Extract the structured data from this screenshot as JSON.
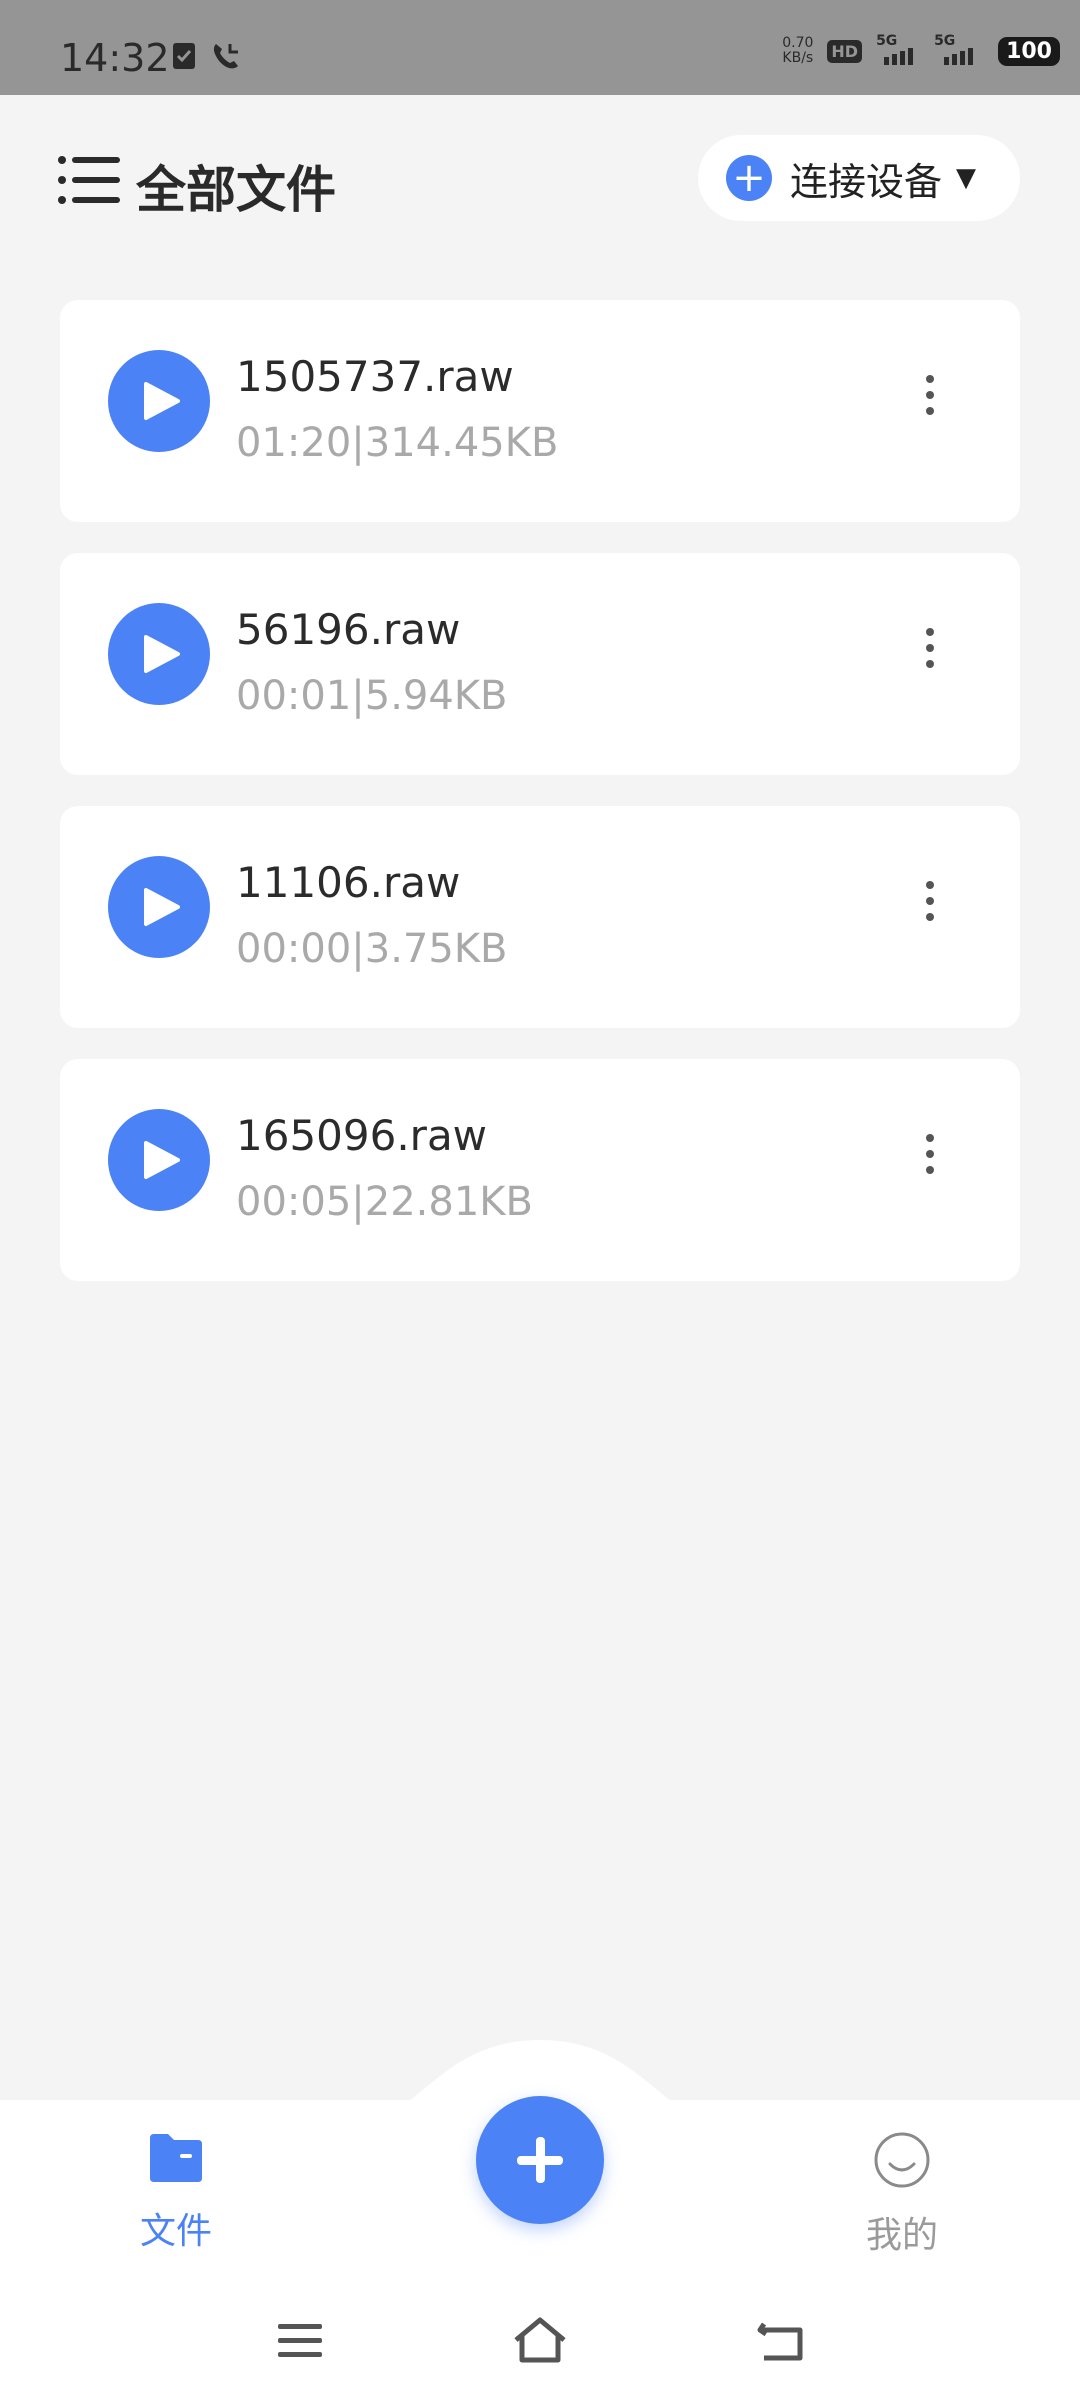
{
  "status_bar": {
    "time": "14:32",
    "net_speed_value": "0.70",
    "net_speed_unit": "KB/s",
    "hd_label": "HD",
    "signal1_label": "5G",
    "signal2_label": "5G",
    "battery": "100"
  },
  "header": {
    "title": "全部文件",
    "connect_label": "连接设备",
    "menu_icon": "list-menu-icon"
  },
  "files": [
    {
      "name": "1505737.raw",
      "meta": "01:20|314.45KB"
    },
    {
      "name": "56196.raw",
      "meta": "00:01|5.94KB"
    },
    {
      "name": "11106.raw",
      "meta": "00:00|3.75KB"
    },
    {
      "name": "165096.raw",
      "meta": "00:05|22.81KB"
    }
  ],
  "bottom_nav": {
    "files_label": "文件",
    "mine_label": "我的"
  },
  "colors": {
    "accent": "#4b82f5",
    "background": "#f4f4f4",
    "card": "#ffffff",
    "meta_text": "#a9a9a9",
    "inactive_tab": "#9a9a9a"
  }
}
